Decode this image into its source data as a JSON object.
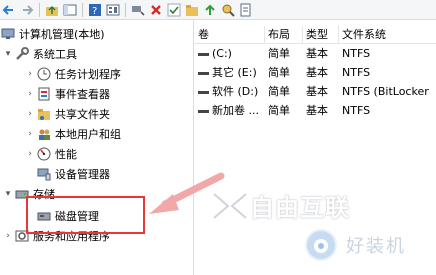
{
  "toolbar": {
    "icons": [
      "back-icon",
      "forward-icon",
      "up-folder-icon",
      "console-tree-icon",
      "help-icon",
      "view-icon",
      "properties-icon",
      "delete-icon",
      "check-icon",
      "folder-icon",
      "export-icon",
      "magnify-icon"
    ]
  },
  "tree": {
    "root": "计算机管理(本地)",
    "system_tools": "系统工具",
    "task_scheduler": "任务计划程序",
    "event_viewer": "事件查看器",
    "shared_folders": "共享文件夹",
    "local_users": "本地用户和组",
    "performance": "性能",
    "device_manager": "设备管理器",
    "storage": "存储",
    "disk_management": "磁盘管理",
    "services_apps": "服务和应用程序"
  },
  "table": {
    "headers": [
      "卷",
      "布局",
      "类型",
      "文件系统"
    ],
    "rows": [
      {
        "volume": "(C:)",
        "layout": "简单",
        "type": "基本",
        "fs": "NTFS"
      },
      {
        "volume": "其它 (E:)",
        "layout": "简单",
        "type": "基本",
        "fs": "NTFS"
      },
      {
        "volume": "软件 (D:)",
        "layout": "简单",
        "type": "基本",
        "fs": "NTFS (BitLocker"
      },
      {
        "volume": "新加卷 ...",
        "layout": "简单",
        "type": "基本",
        "fs": "NTFS"
      }
    ]
  },
  "watermark": {
    "brand": "自由互联",
    "sub": "好装机"
  },
  "colors": {
    "highlight": "#e53935",
    "arrow": "#f1a8a8"
  }
}
